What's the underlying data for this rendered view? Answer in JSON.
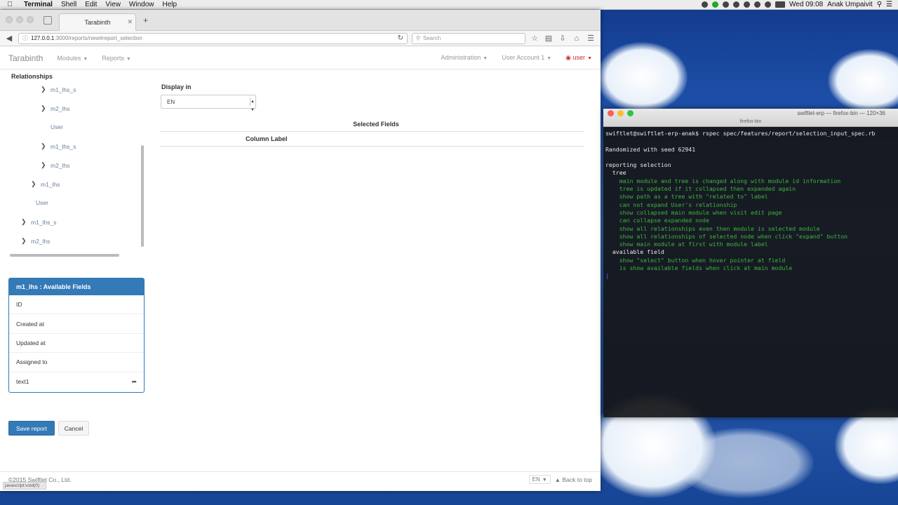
{
  "menubar": {
    "app": "Terminal",
    "items": [
      "Shell",
      "Edit",
      "View",
      "Window",
      "Help"
    ],
    "clock": "Wed 09:08",
    "user": "Anak Umpaivit"
  },
  "browser": {
    "tab_title": "Tarabinth",
    "url_host": "127.0.0.1",
    "url_path": ":3000/reports/new#report_selection",
    "search_placeholder": "Search",
    "status_text": "javascript:void(0)"
  },
  "appnav": {
    "brand": "Tarabinth",
    "modules": "Modules",
    "reports": "Reports",
    "administration": "Administration",
    "user_account": "User Account 1",
    "user": "user"
  },
  "relationships": {
    "title": "Relationships",
    "nodes": [
      {
        "label": "m1_lhs_s",
        "expandable": true
      },
      {
        "label": "m2_lhs",
        "expandable": true
      },
      {
        "label": "User",
        "expandable": false
      },
      {
        "label": "m1_lhs_s",
        "expandable": true
      },
      {
        "label": "m2_lhs",
        "expandable": true
      },
      {
        "label": "m1_lhs",
        "expandable": true
      },
      {
        "label": "User",
        "expandable": false
      },
      {
        "label": "m1_lhs_s",
        "expandable": true
      },
      {
        "label": "m2_lhs",
        "expandable": true
      }
    ]
  },
  "display": {
    "label": "Display in",
    "selected": "EN"
  },
  "selected_fields": {
    "title": "Selected Fields",
    "column_label": "Column Label"
  },
  "available": {
    "title": "m1_lhs : Available Fields",
    "fields": [
      "ID",
      "Created at",
      "Updated at",
      "Assigned to",
      "text1"
    ]
  },
  "actions": {
    "save": "Save report",
    "cancel": "Cancel"
  },
  "footer": {
    "copyright": "©2015 Swiftlet Co., Ltd.",
    "lang": "EN",
    "back_to_top": "Back to top"
  },
  "terminal": {
    "title": "swiftlet-erp — firefox-bin — 120×36",
    "subtitle": "firefox-bin",
    "lines": [
      {
        "text": "swiftlet@swiftlet-erp-anak$ rspec spec/features/report/selection_input_spec.rb",
        "color": "white"
      },
      {
        "text": "",
        "color": "white"
      },
      {
        "text": "Randomized with seed 62941",
        "color": "white"
      },
      {
        "text": "",
        "color": "white"
      },
      {
        "text": "reporting selection",
        "color": "white"
      },
      {
        "text": "  tree",
        "color": "white"
      },
      {
        "text": "    main module and tree is changed along with module id information",
        "color": "green"
      },
      {
        "text": "    tree is updated if it collapsed then expanded again",
        "color": "green"
      },
      {
        "text": "    show path as a tree with \"related to\" label",
        "color": "green"
      },
      {
        "text": "    can not expand User's relationship",
        "color": "green"
      },
      {
        "text": "    show collapsed main module when visit edit page",
        "color": "green"
      },
      {
        "text": "    can collapse expanded node",
        "color": "green"
      },
      {
        "text": "    show all relationships even then module is selected module",
        "color": "green"
      },
      {
        "text": "    show all relationships of selected node when click \"expand\" button",
        "color": "green"
      },
      {
        "text": "    show main module at first with module label",
        "color": "green"
      },
      {
        "text": "  available field",
        "color": "white"
      },
      {
        "text": "    show \"select\" button when hover pointer at field",
        "color": "green"
      },
      {
        "text": "    is show available fields when click at main module",
        "color": "green"
      }
    ]
  }
}
